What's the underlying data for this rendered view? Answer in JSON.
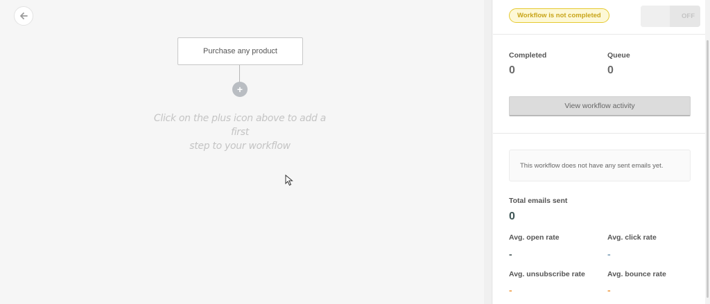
{
  "canvas": {
    "trigger_label": "Purchase any product",
    "plus_label": "+",
    "hint_line1": "Click on the plus icon above to add a first",
    "hint_line2": "step to your workflow"
  },
  "panel": {
    "status_badge": "Workflow is not completed",
    "toggle_label": "OFF",
    "completed_label": "Completed",
    "completed_value": "0",
    "queue_label": "Queue",
    "queue_value": "0",
    "activity_button": "View workflow activity",
    "notice": "This workflow does not have any sent emails yet.",
    "total_sent_label": "Total emails sent",
    "total_sent_value": "0",
    "open_rate_label": "Avg. open rate",
    "open_rate_value": "-",
    "click_rate_label": "Avg. click rate",
    "click_rate_value": "-",
    "unsubscribe_rate_label": "Avg. unsubscribe rate",
    "unsubscribe_rate_value": "-",
    "bounce_rate_label": "Avg. bounce rate",
    "bounce_rate_value": "-"
  },
  "icons": {
    "back": "arrow-left-icon",
    "cursor": "mouse-cursor-icon"
  },
  "colors": {
    "canvas_bg": "#f6f6f6",
    "badge_border": "#e5c92f",
    "badge_text": "#c8a418",
    "open_rate_dash": "#4a5a5a",
    "click_rate_dash": "#7fa0b8",
    "unsubscribe_dash": "#f0a04a",
    "bounce_dash": "#f0a04a"
  }
}
